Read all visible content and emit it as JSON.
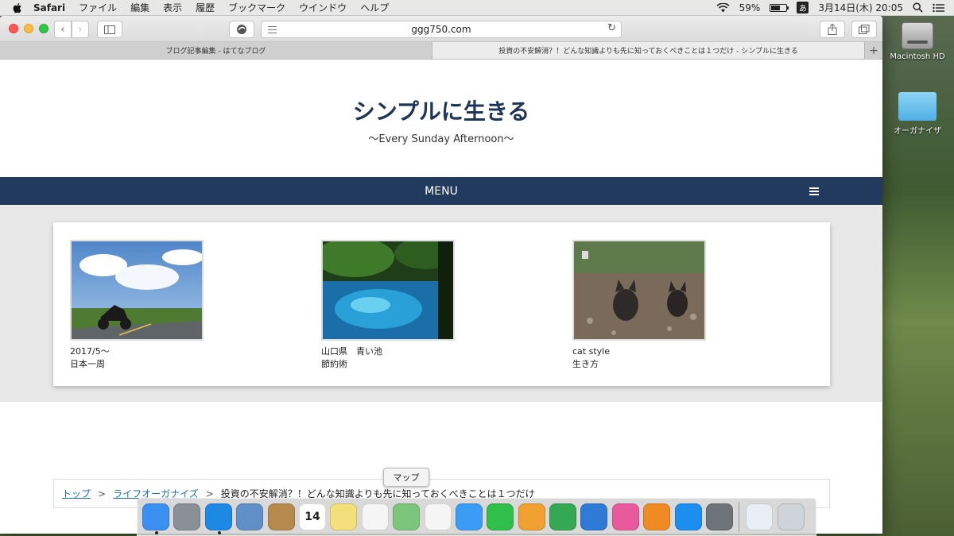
{
  "menubar": {
    "items": [
      "Safari",
      "ファイル",
      "編集",
      "表示",
      "履歴",
      "ブックマーク",
      "ウインドウ",
      "ヘルプ"
    ],
    "battery_percent": "59%",
    "battery_level": 0.59,
    "ime_label": "あ",
    "datetime": "3月14日(木)  20:05"
  },
  "desktop": {
    "items": [
      {
        "label": "Macintosh HD",
        "icon": "hard-drive-icon"
      },
      {
        "label": "オーガナイザ",
        "icon": "folder-icon"
      }
    ]
  },
  "browser": {
    "url": "ggg750.com",
    "tabs": [
      {
        "label": "ブログ記事編集 - はてなブログ",
        "active": false
      },
      {
        "label": "投資の不安解消？！どんな知識よりも先に知っておくべきことは１つだけ - シンプルに生きる",
        "active": true
      }
    ],
    "new_tab_label": "+"
  },
  "site": {
    "title": "シンプルに生きる",
    "subtitle": "〜Every Sunday Afternoon〜",
    "menu_label": "MENU",
    "posts": [
      {
        "line1": "2017/5〜",
        "line2": "日本一周",
        "image": "motorcycle-landscape"
      },
      {
        "line1": "山口県　青い池",
        "line2": "節約術",
        "image": "blue-pond"
      },
      {
        "line1": "cat style",
        "line2": "生き方",
        "image": "kittens"
      }
    ],
    "breadcrumb": {
      "home": "トップ",
      "category": "ライフオーガナイズ",
      "current": "投資の不安解消？！どんな知識よりも先に知っておくべきことは１つだけ",
      "separator": ">"
    }
  },
  "tooltip": {
    "label": "マップ"
  },
  "dock": {
    "apps": [
      {
        "name": "Finder",
        "icon": "finder-icon",
        "color": "#3b8ff0",
        "running": true
      },
      {
        "name": "Launchpad",
        "icon": "rocket-icon",
        "color": "#8a8f98",
        "running": false
      },
      {
        "name": "Safari",
        "icon": "compass-icon",
        "color": "#1e88e5",
        "running": true
      },
      {
        "name": "Mail",
        "icon": "mail-icon",
        "color": "#5f8fc7",
        "running": false
      },
      {
        "name": "Contacts",
        "icon": "contacts-icon",
        "color": "#b58a4c",
        "running": false
      },
      {
        "name": "Calendar",
        "icon": "calendar-icon",
        "color": "#ffffff",
        "running": false,
        "text": "14"
      },
      {
        "name": "Notes",
        "icon": "notes-icon",
        "color": "#f4e07a",
        "running": false
      },
      {
        "name": "Reminders",
        "icon": "reminders-icon",
        "color": "#f5f5f5",
        "running": false
      },
      {
        "name": "Maps",
        "icon": "map-icon",
        "color": "#7bc67b",
        "running": false
      },
      {
        "name": "Photos",
        "icon": "photos-icon",
        "color": "#f5f5f5",
        "running": false
      },
      {
        "name": "Messages",
        "icon": "messages-icon",
        "color": "#3a9cf5",
        "running": false
      },
      {
        "name": "FaceTime",
        "icon": "facetime-icon",
        "color": "#2fbf4a",
        "running": false
      },
      {
        "name": "Pages",
        "icon": "pages-icon",
        "color": "#f0a030",
        "running": false
      },
      {
        "name": "Numbers",
        "icon": "numbers-icon",
        "color": "#35a853",
        "running": false
      },
      {
        "name": "Keynote",
        "icon": "keynote-icon",
        "color": "#2f7ad6",
        "running": false
      },
      {
        "name": "iTunes",
        "icon": "music-icon",
        "color": "#e85a9c",
        "running": false
      },
      {
        "name": "iBooks",
        "icon": "books-icon",
        "color": "#f08a24",
        "running": false
      },
      {
        "name": "App Store",
        "icon": "appstore-icon",
        "color": "#1c8ef0",
        "running": false
      },
      {
        "name": "System Preferences",
        "icon": "gear-icon",
        "color": "#6e737a",
        "running": false
      }
    ],
    "extras": [
      {
        "name": "Downloads stack",
        "icon": "document-stack-icon",
        "color": "#e9eef5"
      },
      {
        "name": "Trash",
        "icon": "trash-icon",
        "color": "#cfd4d9"
      }
    ]
  }
}
